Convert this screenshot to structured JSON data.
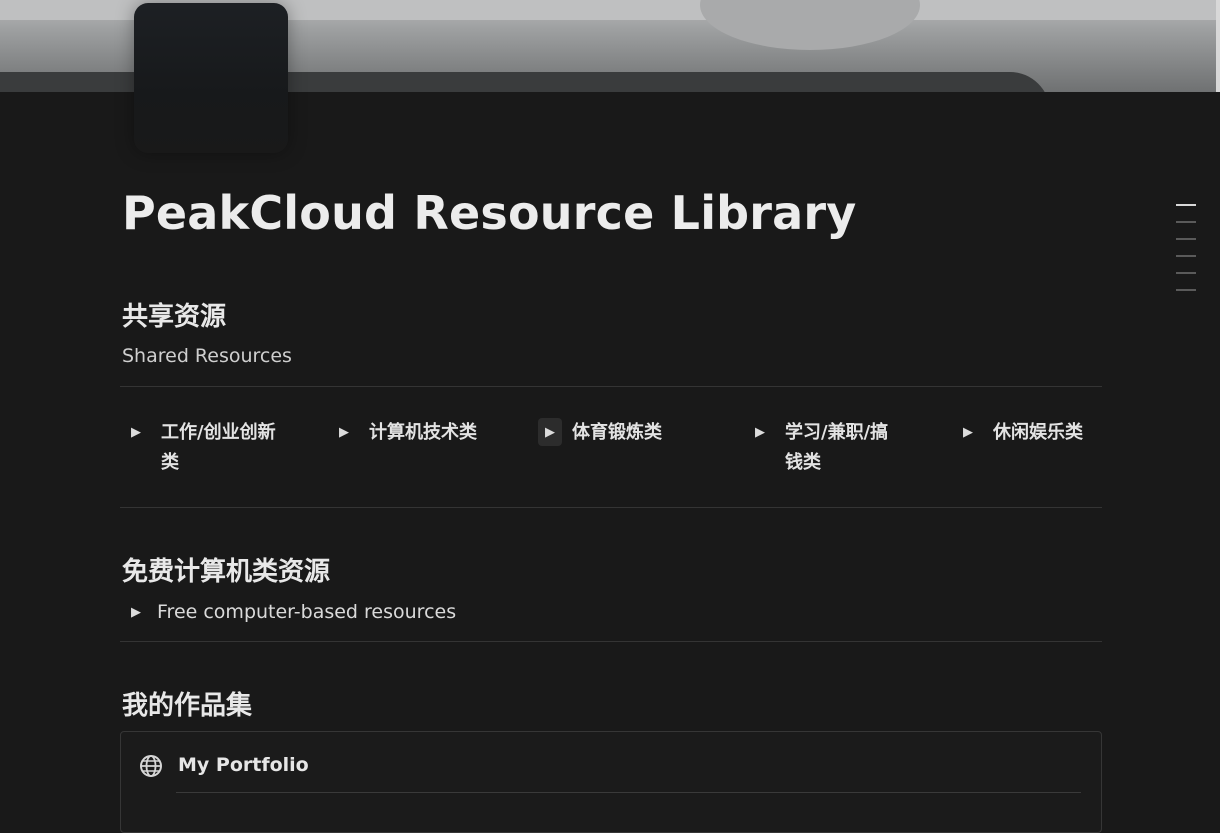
{
  "page": {
    "title": "PeakCloud Resource Library"
  },
  "shared": {
    "heading": "共享资源",
    "subtitle": "Shared Resources",
    "categories": [
      {
        "label": "工作/创业创新类"
      },
      {
        "label": "计算机技术类"
      },
      {
        "label": "体育锻炼类"
      },
      {
        "label": "学习/兼职/搞钱类"
      },
      {
        "label": "休闲娱乐类"
      }
    ]
  },
  "free": {
    "heading": "免费计算机类资源",
    "toggle_label": "Free computer-based resources"
  },
  "portfolio": {
    "heading": "我的作品集",
    "card_title": "My Portfolio",
    "card_icon": "globe-icon"
  },
  "toc": {
    "items": 6,
    "active_index": 0
  },
  "colors": {
    "background": "#191919",
    "text": "#e6e6e6",
    "divider": "#343434"
  }
}
